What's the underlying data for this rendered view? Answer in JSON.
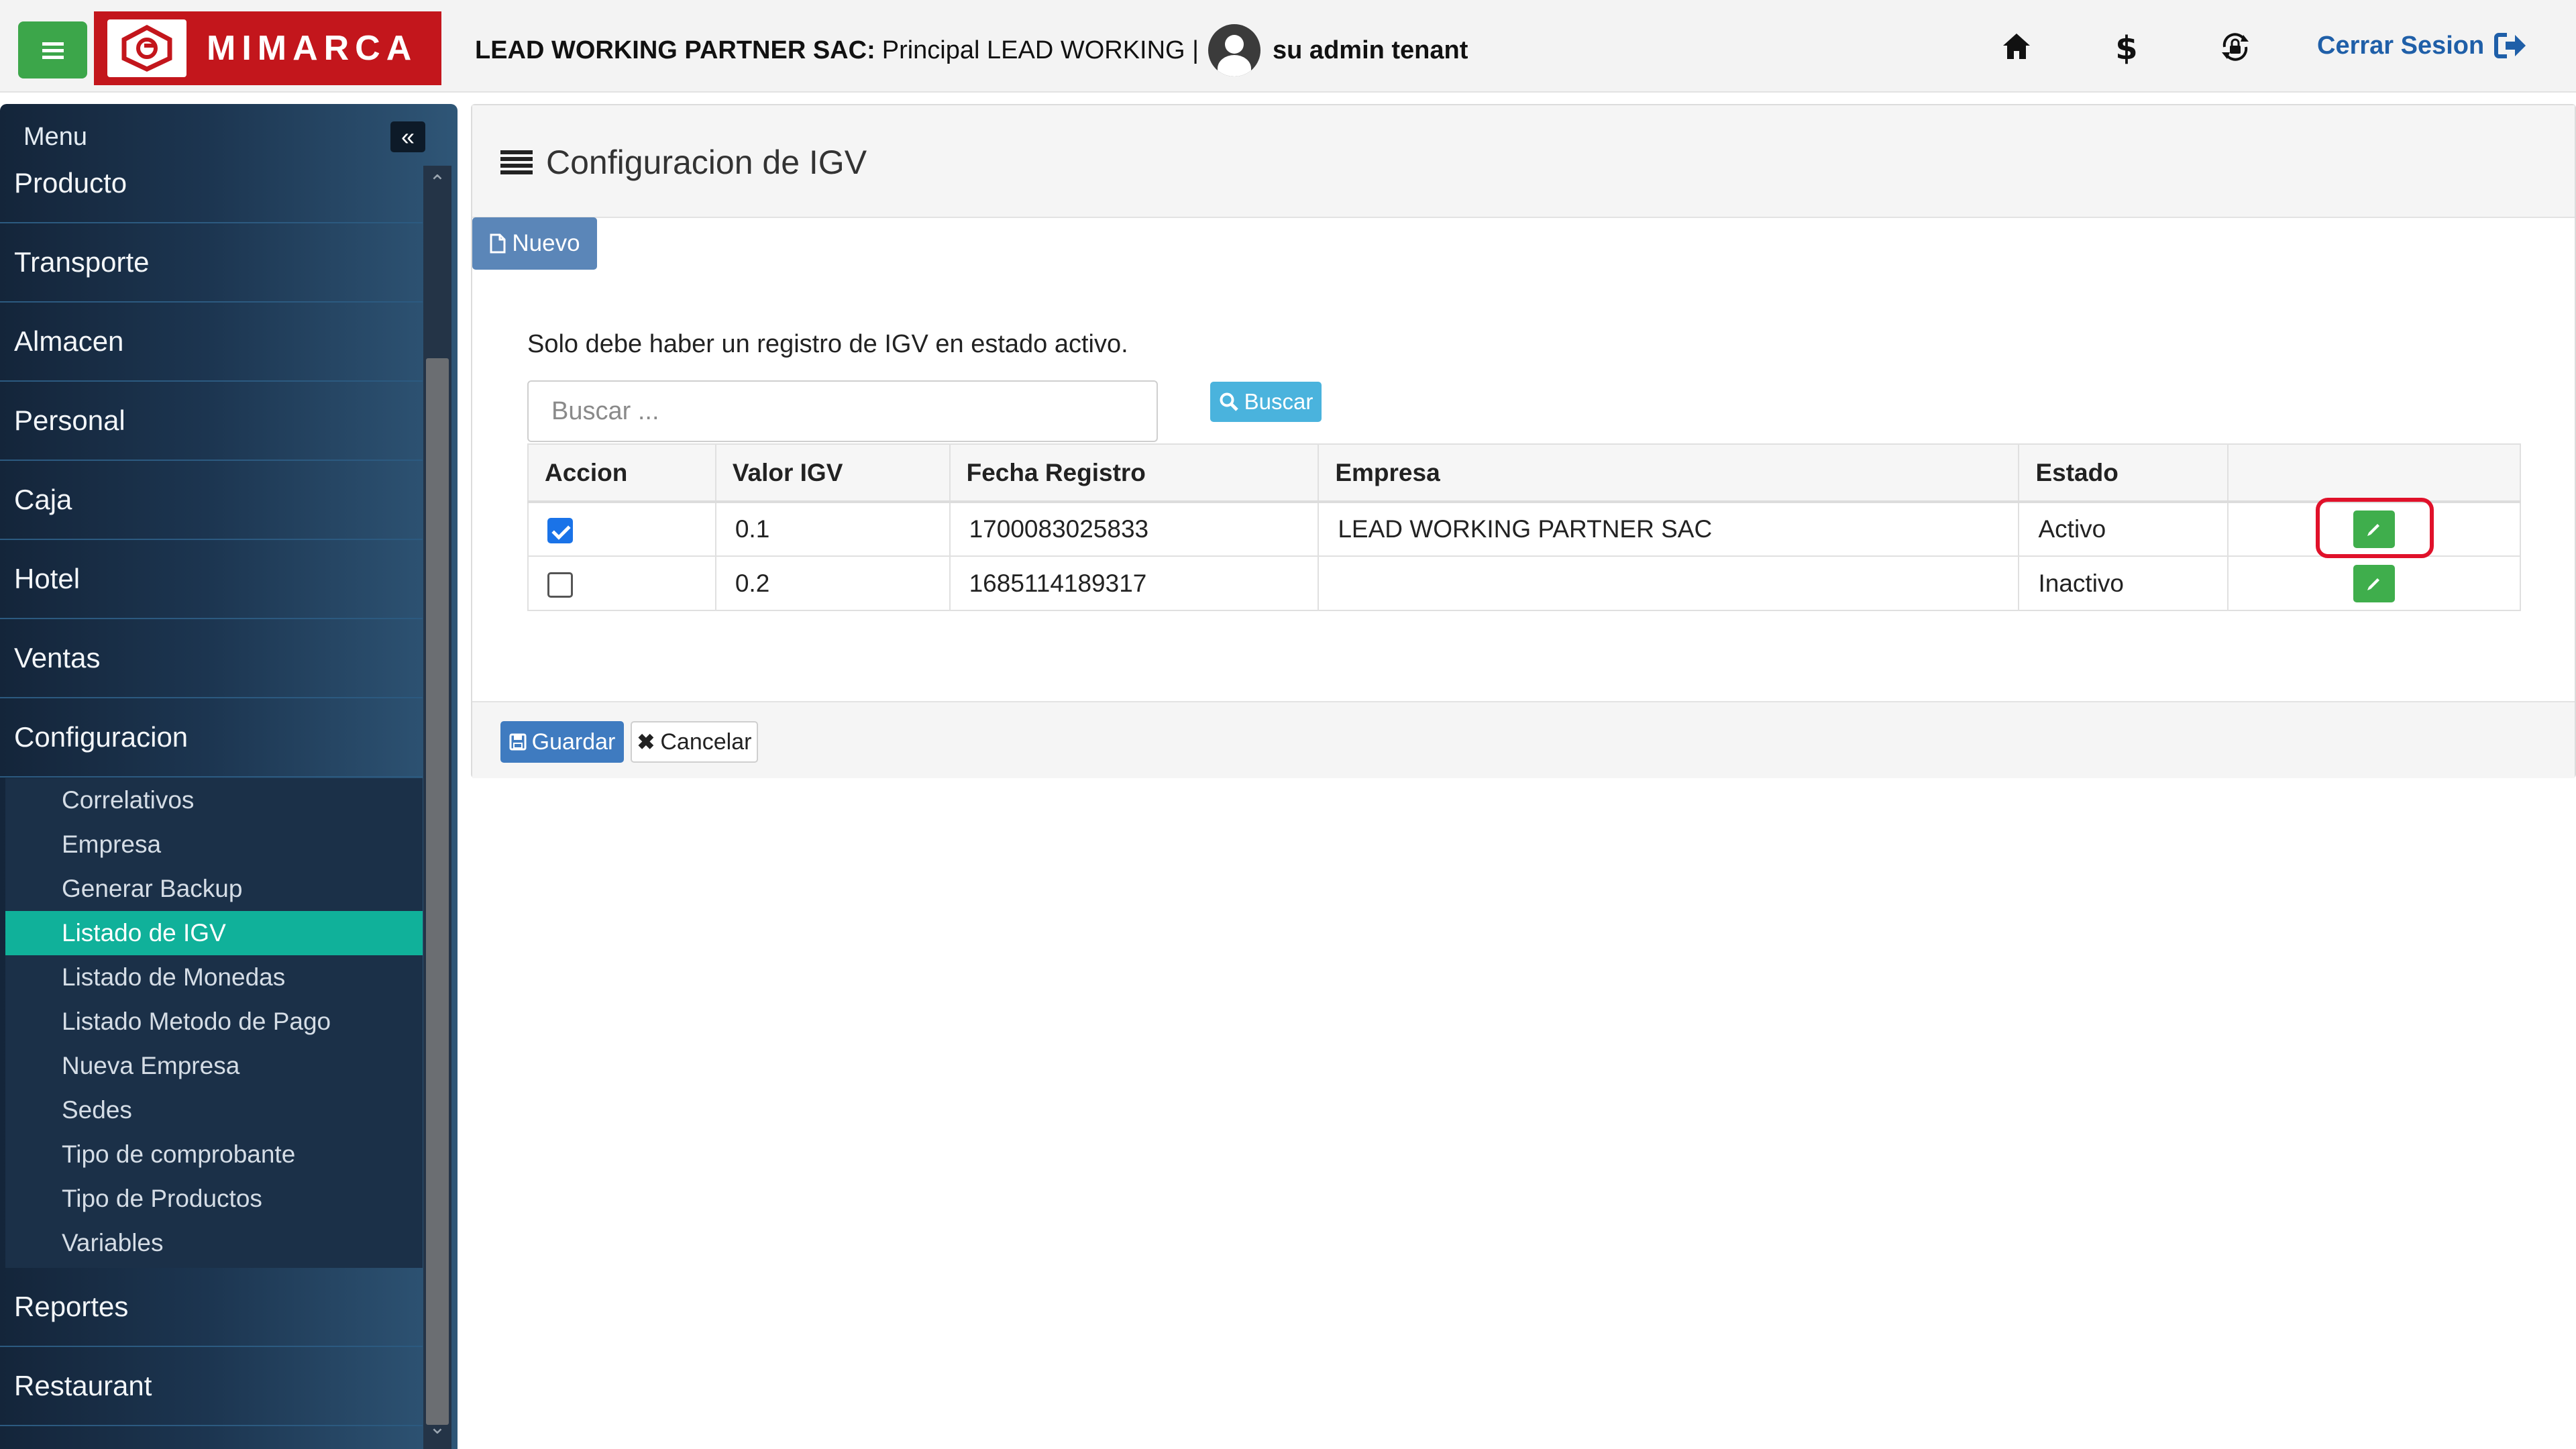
{
  "header": {
    "company_name": "LEAD WORKING PARTNER SAC:",
    "branch": "Principal LEAD WORKING |",
    "user": "su admin tenant",
    "logo_text": "MIMARCA",
    "logout_label": "Cerrar Sesion",
    "icons": [
      "menu-icon",
      "home-icon",
      "dollar-icon",
      "lock-icon",
      "logout-icon"
    ]
  },
  "sidebar": {
    "title": "Menu",
    "collapse_glyph": "«",
    "items": [
      {
        "label": "Producto"
      },
      {
        "label": "Transporte"
      },
      {
        "label": "Almacen"
      },
      {
        "label": "Personal"
      },
      {
        "label": "Caja"
      },
      {
        "label": "Hotel"
      },
      {
        "label": "Ventas"
      },
      {
        "label": "Configuracion"
      },
      {
        "label": "Reportes"
      },
      {
        "label": "Restaurant"
      }
    ],
    "submenu": [
      {
        "label": "Correlativos"
      },
      {
        "label": "Empresa"
      },
      {
        "label": "Generar Backup"
      },
      {
        "label": "Listado de IGV",
        "active": true
      },
      {
        "label": "Listado de Monedas"
      },
      {
        "label": "Listado Metodo de Pago"
      },
      {
        "label": "Nueva Empresa"
      },
      {
        "label": "Sedes"
      },
      {
        "label": "Tipo de comprobante"
      },
      {
        "label": "Tipo de Productos"
      },
      {
        "label": "Variables"
      }
    ]
  },
  "main": {
    "title": "Configuracion de IGV",
    "new_button": "Nuevo",
    "notice": "Solo debe haber un registro de IGV en estado activo.",
    "search": {
      "placeholder": "Buscar ...",
      "value": "",
      "button": "Buscar"
    },
    "table": {
      "columns": [
        "Accion",
        "Valor IGV",
        "Fecha Registro",
        "Empresa",
        "Estado",
        ""
      ],
      "rows": [
        {
          "checked": true,
          "valor": "0.1",
          "fecha": "1700083025833",
          "empresa": "LEAD WORKING PARTNER SAC",
          "estado": "Activo"
        },
        {
          "checked": false,
          "valor": "0.2",
          "fecha": "1685114189317",
          "empresa": "",
          "estado": "Inactivo"
        }
      ]
    },
    "save_button": "Guardar",
    "cancel_button": "Cancelar"
  },
  "colors": {
    "brand_red": "#c3161c",
    "menu_green": "#3ca64a",
    "active_teal": "#10b19a",
    "edit_green": "#3fae4c",
    "highlight_red": "#e0112a",
    "link_blue": "#1f5fa8"
  }
}
